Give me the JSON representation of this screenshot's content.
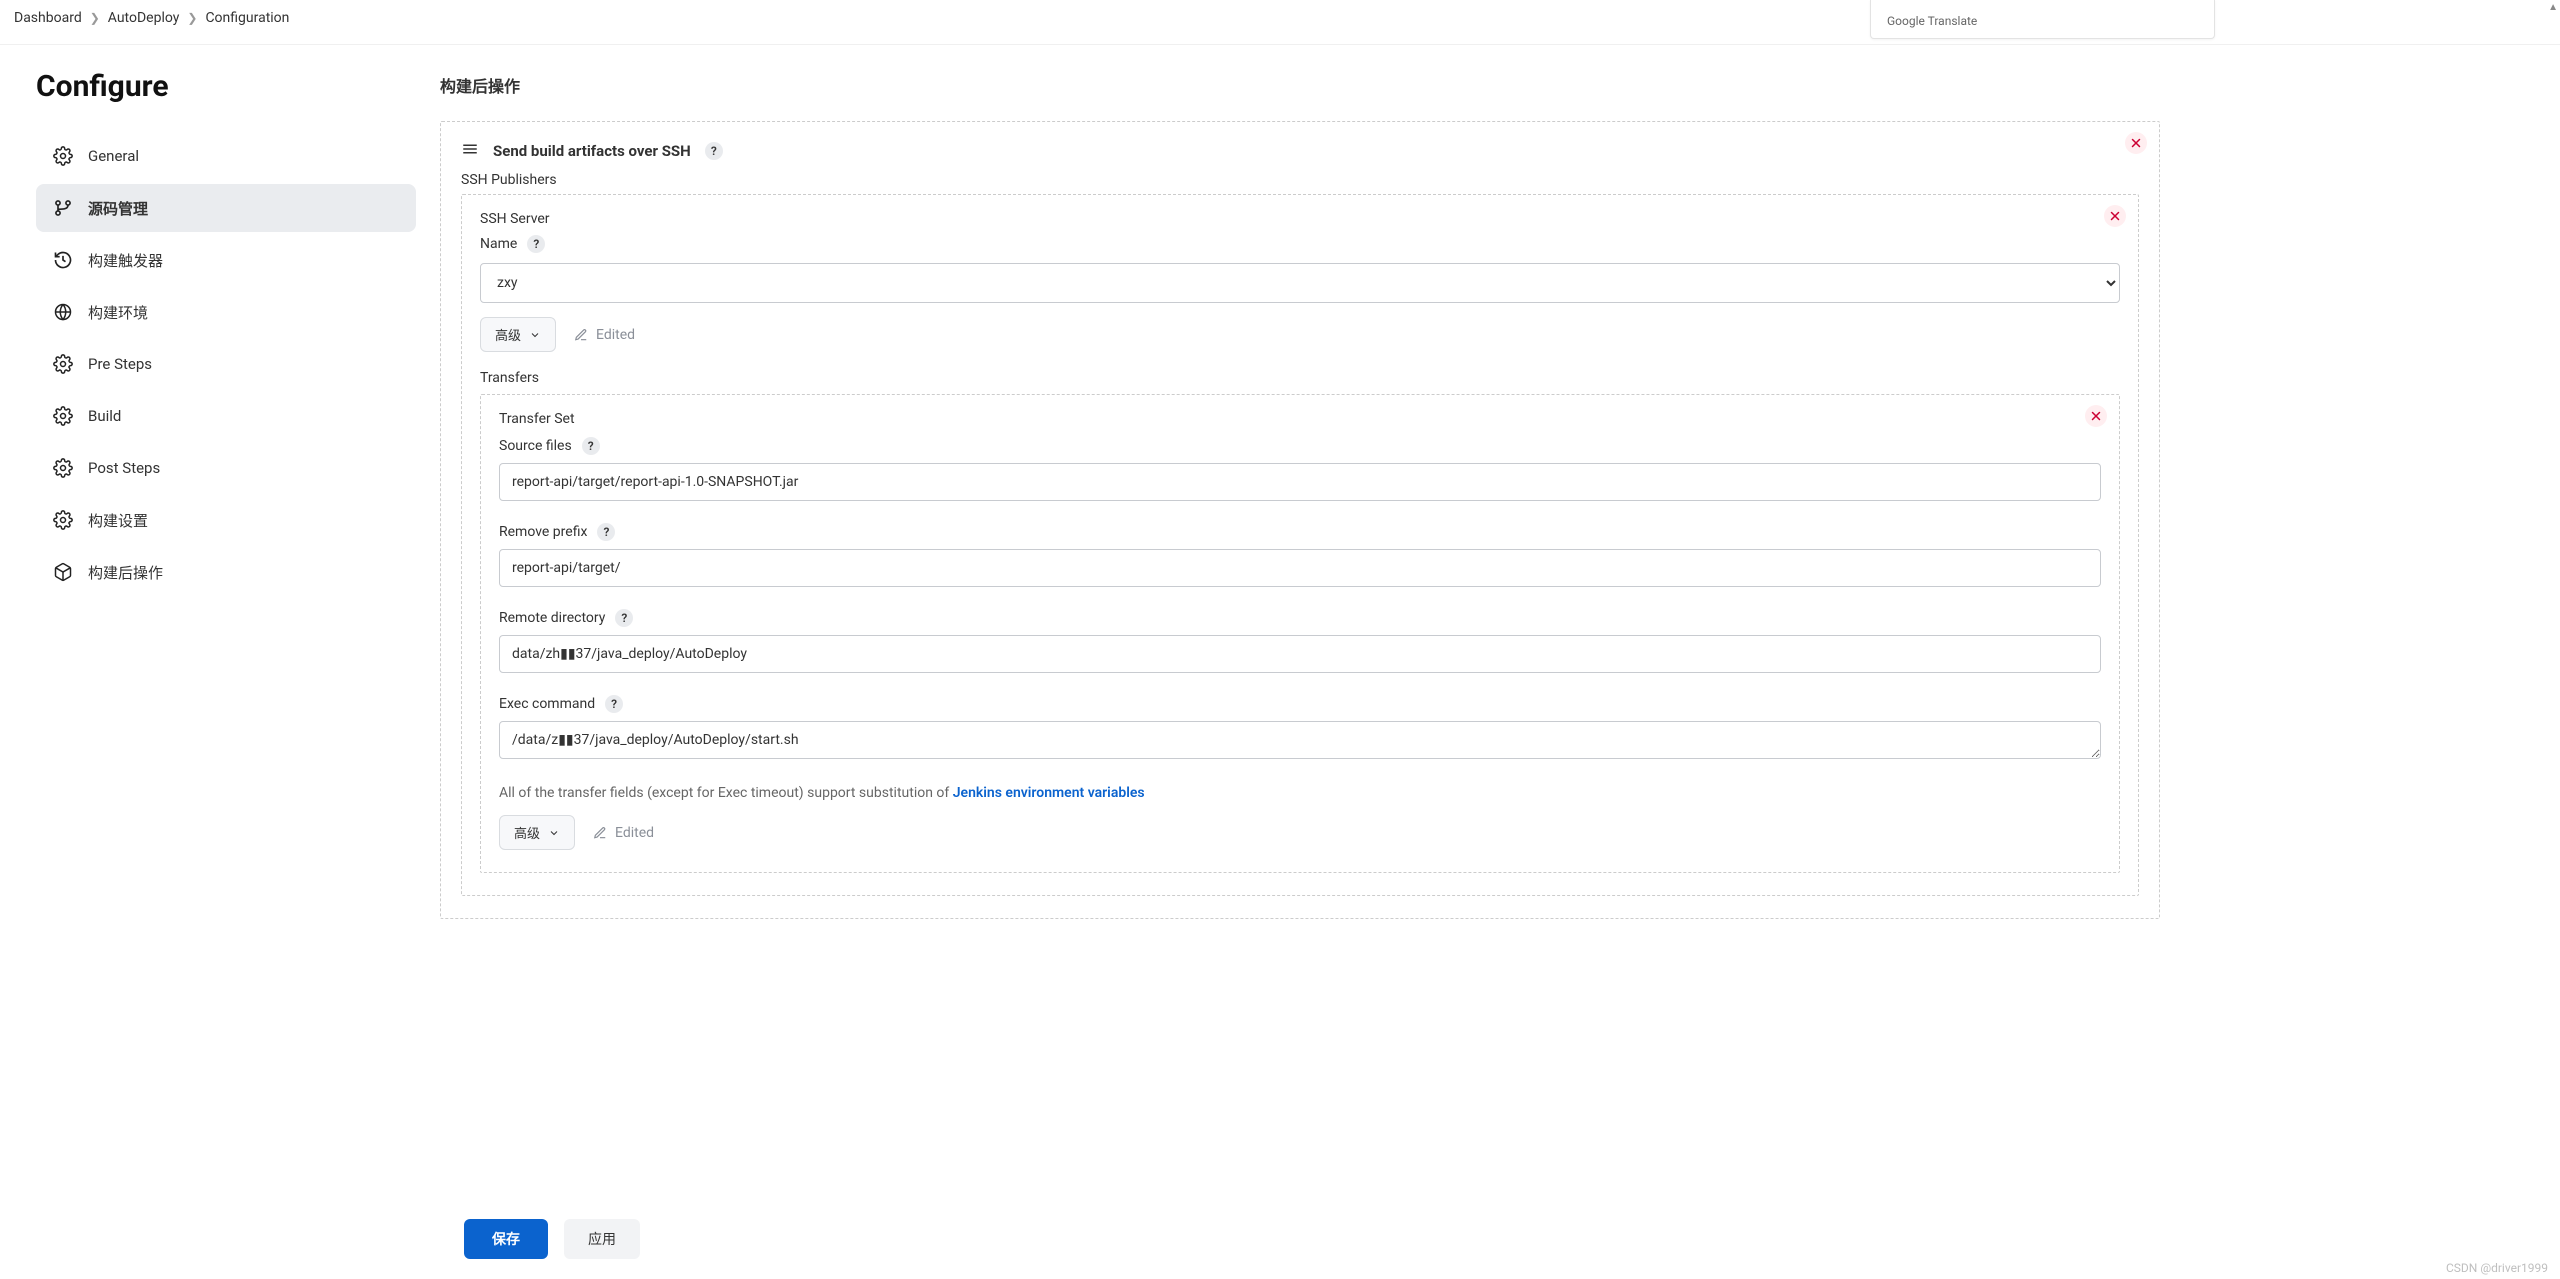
{
  "breadcrumbs": [
    "Dashboard",
    "AutoDeploy",
    "Configuration"
  ],
  "gtranslate_label": "Google Translate",
  "page_title": "Configure",
  "sidebar_items": [
    {
      "label": "General",
      "icon": "gear"
    },
    {
      "label": "源码管理",
      "icon": "branch",
      "active": true
    },
    {
      "label": "构建触发器",
      "icon": "history"
    },
    {
      "label": "构建环境",
      "icon": "globe"
    },
    {
      "label": "Pre Steps",
      "icon": "gear"
    },
    {
      "label": "Build",
      "icon": "gear"
    },
    {
      "label": "Post Steps",
      "icon": "gear"
    },
    {
      "label": "构建设置",
      "icon": "gear"
    },
    {
      "label": "构建后操作",
      "icon": "package"
    }
  ],
  "section_title": "构建后操作",
  "ssh_block": {
    "title": "Send build artifacts over SSH",
    "publishers_label": "SSH Publishers",
    "server": {
      "heading": "SSH Server",
      "name_label": "Name",
      "selected": "zxy"
    },
    "advanced_label": "高级",
    "edited_label": "Edited",
    "transfers_label": "Transfers",
    "transfer_set": {
      "heading": "Transfer Set",
      "source_files_label": "Source files",
      "source_files_value": "report-api/target/report-api-1.0-SNAPSHOT.jar",
      "remove_prefix_label": "Remove prefix",
      "remove_prefix_value": "report-api/target/",
      "remote_dir_label": "Remote directory",
      "remote_dir_value": "data/zh▮▮37/java_deploy/AutoDeploy",
      "exec_label": "Exec command",
      "exec_value": "/data/z▮▮37/java_deploy/AutoDeploy/start.sh",
      "hint_prefix": "All of the transfer fields (except for Exec timeout) support substitution of ",
      "hint_link": "Jenkins environment variables"
    }
  },
  "buttons": {
    "save": "保存",
    "apply": "应用"
  },
  "watermark": "CSDN @driver1999"
}
